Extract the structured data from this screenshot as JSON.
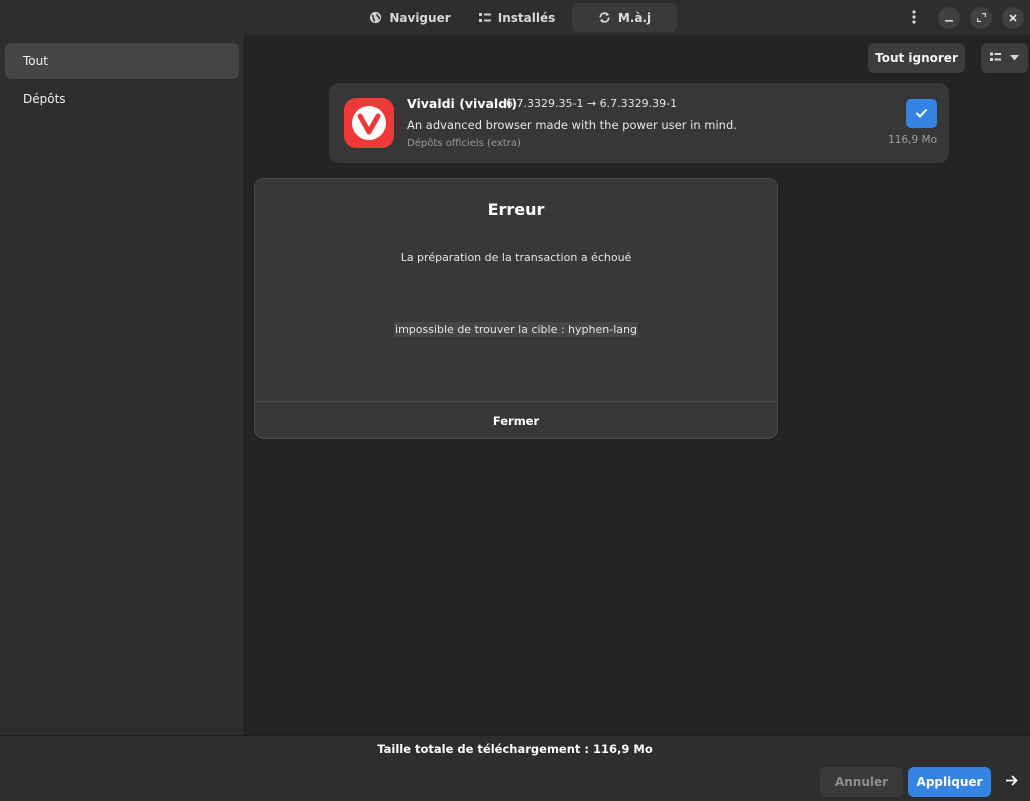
{
  "header": {
    "tabs": [
      {
        "label": "Naviguer",
        "icon": "globe-icon"
      },
      {
        "label": "Installés",
        "icon": "list-icon"
      },
      {
        "label": "M.à.j",
        "icon": "refresh-icon",
        "active": true
      }
    ],
    "window_controls": [
      "menu-dots-icon",
      "minimize-icon",
      "restore-icon",
      "close-icon"
    ]
  },
  "sidebar": {
    "items": [
      {
        "label": "Tout",
        "active": true
      },
      {
        "label": "Dépôts"
      }
    ]
  },
  "toolbar": {
    "ignore_all_label": "Tout ignorer",
    "view_icon": "view-list-icon"
  },
  "update": {
    "name": "Vivaldi (vivaldi)",
    "version": "6.7.3329.35-1 → 6.7.3329.39-1",
    "description": "An advanced browser made with the power user in mind.",
    "repository": "Dépôts officiels (extra)",
    "size": "116,9 Mo",
    "selected": true
  },
  "dialog": {
    "title": "Erreur",
    "message": "La préparation de la transaction a échoué",
    "detail": "impossible de trouver la cible : hyphen-lang",
    "close_label": "Fermer"
  },
  "footer": {
    "total": "Taille totale de téléchargement : 116,9 Mo",
    "cancel_label": "Annuler",
    "apply_label": "Appliquer"
  },
  "colors": {
    "accent": "#3584e4",
    "background": "#242424",
    "sidebar": "#2e2e2e",
    "vivaldi_red": "#ef3939"
  }
}
